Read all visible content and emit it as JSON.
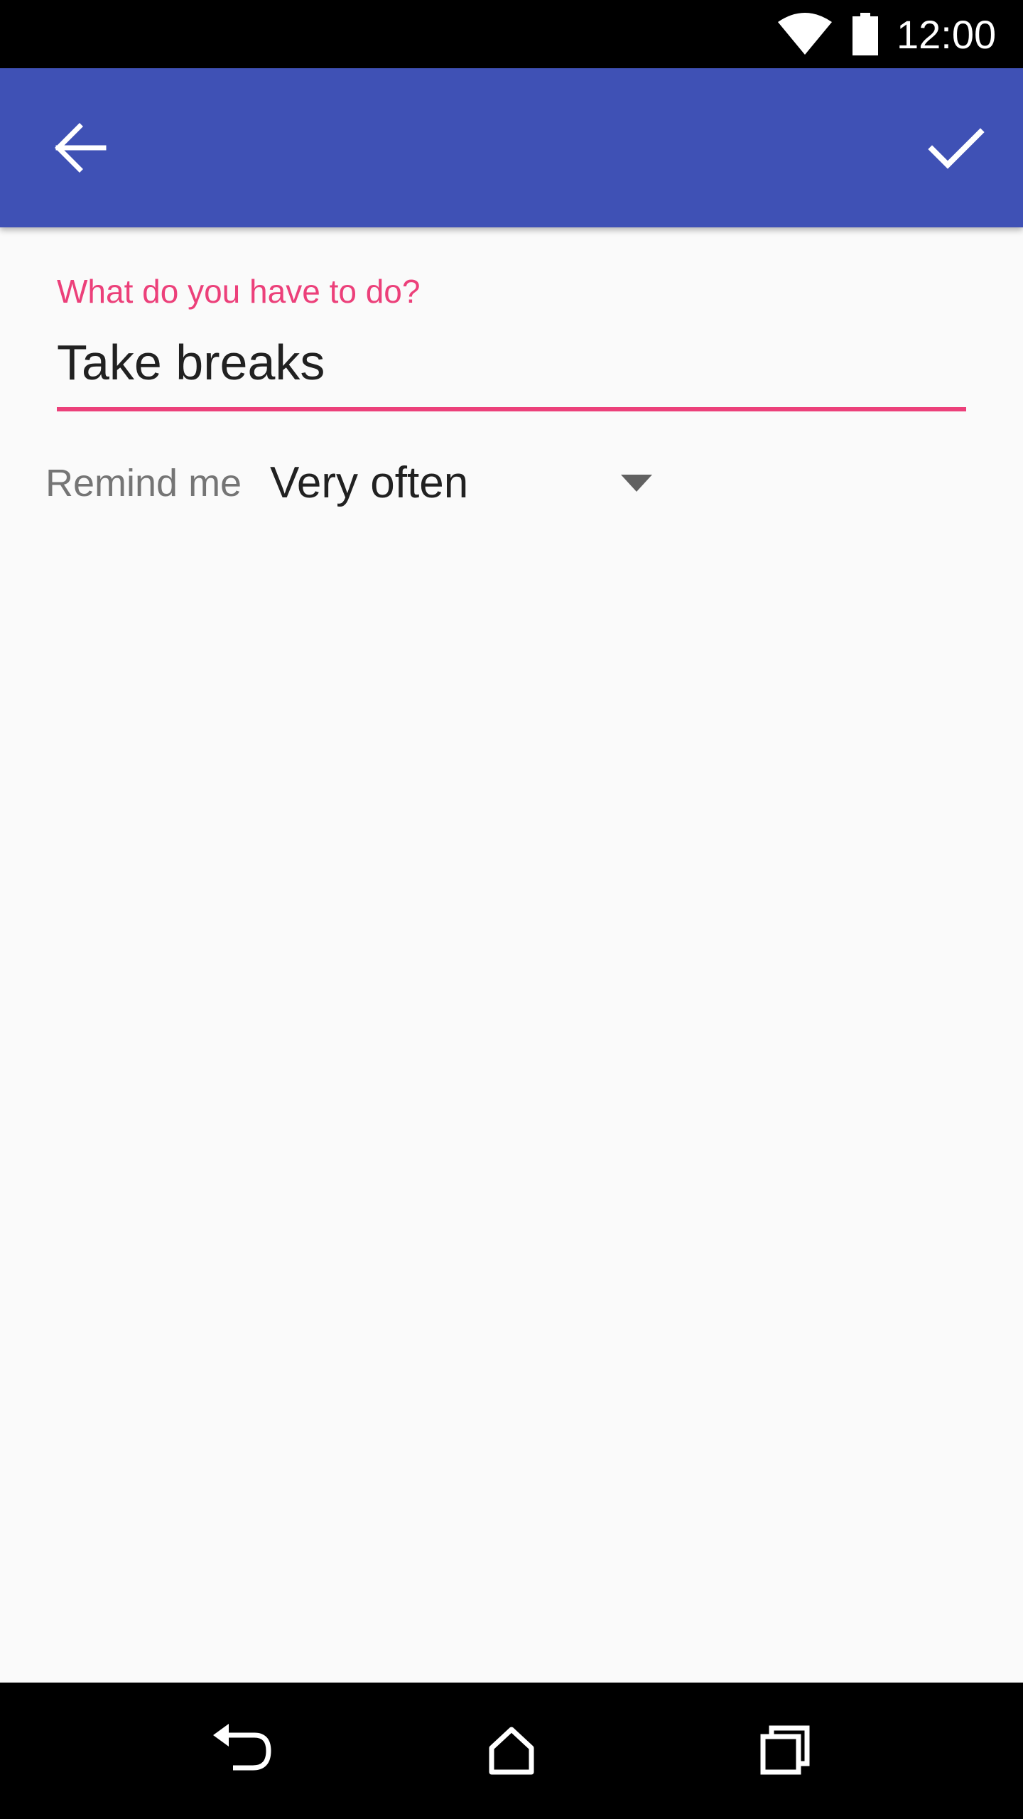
{
  "status_bar": {
    "time": "12:00",
    "icons": [
      "wifi-icon",
      "battery-icon"
    ]
  },
  "app_bar": {
    "color": "#3f51b5",
    "back_icon": "arrow-back-icon",
    "done_icon": "check-icon"
  },
  "form": {
    "task_label": "What do you have to do?",
    "task_value": "Take breaks",
    "accent_color": "#ec407a",
    "remind_label": "Remind me",
    "remind_value": "Very often",
    "dropdown_icon": "arrow-drop-down-icon"
  },
  "nav_bar": {
    "icons": [
      "back-nav-icon",
      "home-nav-icon",
      "recents-nav-icon"
    ]
  }
}
